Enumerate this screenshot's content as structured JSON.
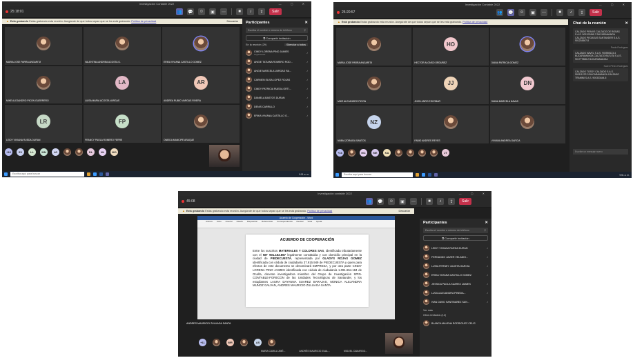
{
  "common": {
    "recording_banner": {
      "title": "Está grabando",
      "text": "Estás grabando esta reunión. Asegúrate de que todos sepan que se les está grabando.",
      "link": "Política de privacidad",
      "dismiss": "Descartar"
    },
    "leave_label": "Salir",
    "search_placeholder": "Escriba aquí para buscar",
    "participants_title": "Participantes",
    "invite_placeholder": "Escriba el nombre o número de teléfono",
    "share_invite": "Compartir invitación",
    "clock": "9:51 a. m."
  },
  "shot1": {
    "window_title": "Investigación Contable 2022",
    "timer": "25:18:01",
    "tiles": [
      {
        "name": "MARIA JOSE PARRA ANGARITA",
        "initials": "",
        "photo": true,
        "color": ""
      },
      {
        "name": "VALENTINA ANDREA ACOSTA G.",
        "initials": "",
        "photo": true,
        "color": ""
      },
      {
        "name": "ERIKA VIVIANA CASTILLO GOMEZ",
        "initials": "",
        "photo": true,
        "color": ""
      },
      {
        "name": "MIKE ALEJANDRO PICON GUERRERO",
        "initials": "",
        "photo": true,
        "color": ""
      },
      {
        "name": "LUISA MARIA ACOSTA VARGAS",
        "initials": "LA",
        "photo": false,
        "color": "#e2b8c6"
      },
      {
        "name": "ANDREA RUBIO VARGAS RIVERA",
        "initials": "AR",
        "photo": false,
        "color": "#f0c8b8"
      },
      {
        "name": "LEIDY VIVIANA RUEDA DURAN",
        "initials": "LR",
        "photo": false,
        "color": "#c6d9c6"
      },
      {
        "name": "FRANCY PAOLA ROMERO FERRE",
        "initials": "FP",
        "photo": false,
        "color": "#c6dfc8"
      },
      {
        "name": "ONEIDA MANCIPE ARAQUE",
        "initials": "",
        "photo": true,
        "color": ""
      }
    ],
    "strip": [
      {
        "initials": "+16",
        "color": "#b8bdf0"
      },
      {
        "initials": "SV",
        "color": "#c8d0f0"
      },
      {
        "initials": "LL",
        "color": "#d4e6d0"
      },
      {
        "initials": "MN",
        "color": "#c9e4d5"
      },
      {
        "initials": "LG",
        "color": "#d1d6f2"
      },
      {
        "initials": "",
        "color": ""
      },
      {
        "initials": "",
        "color": ""
      },
      {
        "initials": "DL",
        "color": "#e6c9dd"
      },
      {
        "initials": "NL",
        "color": "#e6d0f0"
      },
      {
        "initials": "MO",
        "color": "#f0dcc0"
      }
    ],
    "participants_section": "En la reunión (29)",
    "mute_all": "Silenciar a todos",
    "participants": [
      {
        "name": "CINDY LORENA PINO JAIMES",
        "sub": "Organizador"
      },
      {
        "name": "ANGIE TATIANA ROMERO ROD...",
        "sub": ""
      },
      {
        "name": "ANGIE MARCELA VARGAS RA...",
        "sub": ""
      },
      {
        "name": "CARMEN ELISA LOPEZ ROJAS",
        "sub": ""
      },
      {
        "name": "CINDY PATRICIA RUEDA ORTI...",
        "sub": ""
      },
      {
        "name": "DANIELA BASTOS DURAN",
        "sub": ""
      },
      {
        "name": "DENIS CARRILLO",
        "sub": ""
      },
      {
        "name": "ERIKA VIVIANA CASTILLO G...",
        "sub": ""
      }
    ]
  },
  "shot2": {
    "window_title": "Investigación Contable 2022",
    "timer": "25:20:57",
    "tiles": [
      {
        "name": "MARIA JOSE PARRA ANGARITA",
        "initials": "",
        "photo": true,
        "color": ""
      },
      {
        "name": "HECTOR ALONSO ORDUÑEZ",
        "initials": "HO",
        "photo": false,
        "color": "#f2c8cd"
      },
      {
        "name": "DIANA PATRICIA GOMEZ",
        "initials": "",
        "photo": true,
        "color": ""
      },
      {
        "name": "MIKE ALEJANDRO PICON",
        "initials": "",
        "photo": true,
        "color": ""
      },
      {
        "name": "JHON JAIRO ESCOBAR",
        "initials": "JJ",
        "photo": false,
        "color": "#efd4b8"
      },
      {
        "name": "DIANA MARCELA NAVAS",
        "initials": "DN",
        "photo": false,
        "color": "#f2c9d0"
      },
      {
        "name": "NUBIA ZORAIDA SANTOS",
        "initials": "NZ",
        "photo": false,
        "color": "#c6d4ec"
      },
      {
        "name": "FABIO ANDRES REYES",
        "initials": "",
        "photo": true,
        "color": ""
      },
      {
        "name": "VIVIANA ANDREA GARCIA",
        "initials": "",
        "photo": true,
        "color": ""
      }
    ],
    "strip": [
      {
        "initials": "+16",
        "color": "#b8bdf0"
      },
      {
        "initials": "",
        "color": ""
      },
      {
        "initials": "MC",
        "color": "#e6d0f0"
      },
      {
        "initials": "ME",
        "color": "#d7c9ee"
      },
      {
        "initials": "KA",
        "color": "#f0e0b8"
      },
      {
        "initials": "",
        "color": ""
      },
      {
        "initials": "",
        "color": ""
      },
      {
        "initials": "",
        "color": ""
      },
      {
        "initials": "",
        "color": ""
      },
      {
        "initials": "JT",
        "color": "#e8c8d8"
      }
    ],
    "chat_title": "Chat de la reunión",
    "chat_messages": [
      {
        "meta": "",
        "text": "CALZADO PRAXIS CALZADO DE ROSAS S.A.S. 900123456-7 BUCARAMANGA CALZADO PEGASUS SANTANDER S.A.S. 901234567-8"
      },
      {
        "meta": "Paula Rodríguez",
        "text": "CALZADO NAVEL S.A.S. 900555123-4 BUCARAMANGA CALZADO BATUTA S.A.S. 901777888-2 BUCARAMANGA"
      },
      {
        "meta": "Karen Pérez Rodríguez",
        "text": "CALZADO TOSSY CALZADO S.A.S. 900111222-3 BUCARAMANGA CALZADO TRAMINI S.A.S. 900333444-5"
      }
    ],
    "chat_compose": "Escribe un mensaje nuevo"
  },
  "shot3": {
    "window_title": "Investigación contable 2022",
    "timer": "45:08",
    "doc_window": "Acuerdo de Cooperación - Word",
    "doc_tabs": "Archivo Inicio Insertar Diseño Disposición Referencias Correspondencia Revisar Vista Ayuda",
    "doc_title": "ACUERDO DE COOPERACIÓN",
    "doc_p1": "Entre los suscritos ",
    "doc_company": "MATERIALES Y COLORES SAS",
    "doc_p2": ", identificada tributariamente con el ",
    "doc_nit": "NIT 901.152.867",
    "doc_p3": " legalmente constituida y con domicilio principal en la ciudad de ",
    "doc_city": "PIEDECUESTA",
    "doc_p4": ", representada por ",
    "doc_rep": "GLADYS ROJAS GOMEZ",
    "doc_p5": " identificada con cédula de ciudadanía 37.915.949 de PIEDECUESTA y quien para efectos de este documento se denominará EMPRESA, y por otra parte CINDY LORENA PINO JAIMES identificada con cédula de ciudadanía 1.091.654.184 de Ocaña, docente investigadora miembro del Grupo de Investigación SPIN-CONTABLE-FORECON de las Unidades Tecnológicas de Santander, y los estudiantes LAURA DAYANNA SUAREZ BARAJAS, MONICA ALEJANDRA MUÑOZ GALVAN, ANDRES MAURICIO ZULUAGA SANTA.",
    "presenter": "ANDRES MAURICIO ZULUAGA SANTA",
    "strip": [
      {
        "initials": "+11",
        "color": "#b8bdf0"
      },
      {
        "initials": "",
        "color": ""
      },
      {
        "initials": "WR",
        "color": "#f0c8b8"
      },
      {
        "initials": "",
        "color": ""
      },
      {
        "initials": "AS",
        "color": "#c8d6ec"
      },
      {
        "initials": "",
        "color": ""
      }
    ],
    "strip_names": [
      "MARIA CAMILA JIMÉ...",
      "ANDRÉS MAURICIO ZUAL...",
      "MIGUEL CAMARGO..."
    ],
    "participants": [
      {
        "name": "LEIDY VIVIANA RUEDA DURAN",
        "sub": ""
      },
      {
        "name": "FERNANDO JAVIER VELANDI...",
        "sub": ""
      },
      {
        "name": "LUISA FERNEY JULIETA GARCÍA",
        "sub": ""
      },
      {
        "name": "ERIKA VIVIANA CASTILLO GOMEZ",
        "sub": ""
      },
      {
        "name": "JESSICA PAOLA SUAREZ JAIMES",
        "sub": ""
      },
      {
        "name": "LUCIA ALEJANDRA PINEDA...",
        "sub": ""
      },
      {
        "name": "IVAN DAVID SANTIBAÑEZ SAN...",
        "sub": ""
      }
    ],
    "see_more": "Ver más",
    "others_section": "Otros invitados (12)",
    "others_first": "BLANCA MALENA RODRIGUEZ CELIS"
  }
}
